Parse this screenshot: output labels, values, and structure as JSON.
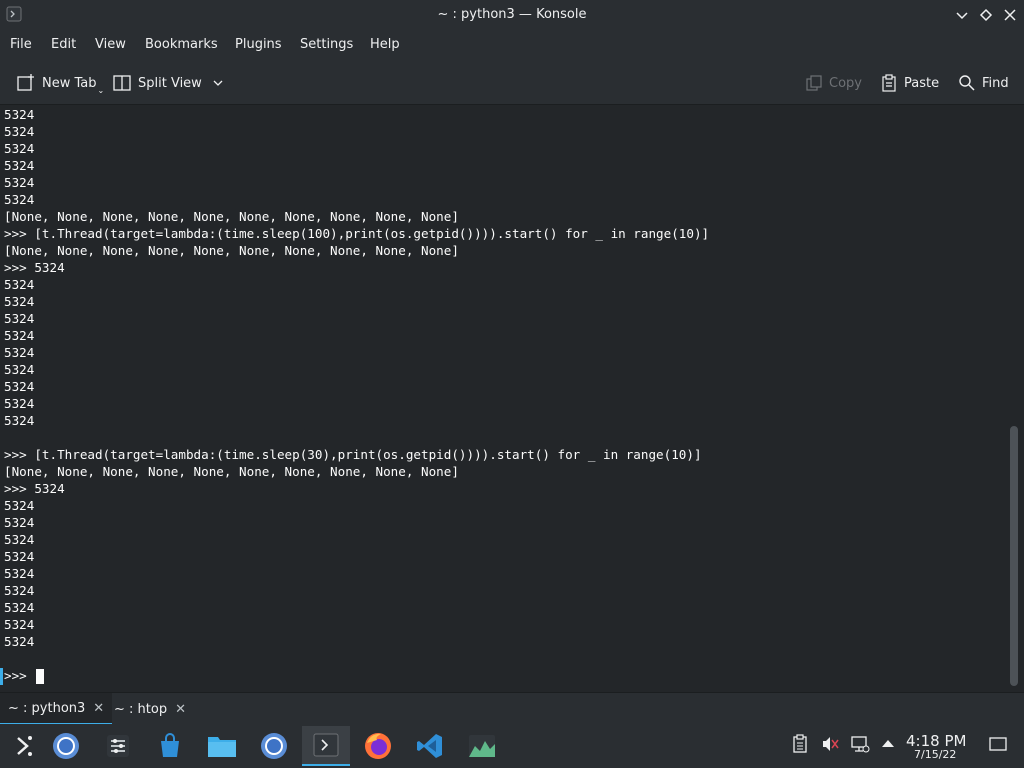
{
  "window": {
    "title": "~ : python3 — Konsole"
  },
  "menu": {
    "items": [
      "File",
      "Edit",
      "View",
      "Bookmarks",
      "Plugins",
      "Settings",
      "Help"
    ]
  },
  "toolbar": {
    "new_tab": "New Tab",
    "split_view": "Split View",
    "copy": "Copy",
    "paste": "Paste",
    "find": "Find"
  },
  "terminal": {
    "lines": [
      "5324",
      "5324",
      "5324",
      "5324",
      "5324",
      "5324",
      "[None, None, None, None, None, None, None, None, None, None]",
      ">>> [t.Thread(target=lambda:(time.sleep(100),print(os.getpid()))).start() for _ in range(10)]",
      "[None, None, None, None, None, None, None, None, None, None]",
      ">>> 5324",
      "5324",
      "5324",
      "5324",
      "5324",
      "5324",
      "5324",
      "5324",
      "5324",
      "5324",
      "",
      ">>> [t.Thread(target=lambda:(time.sleep(30),print(os.getpid()))).start() for _ in range(10)]",
      "[None, None, None, None, None, None, None, None, None, None]",
      ">>> 5324",
      "5324",
      "5324",
      "5324",
      "5324",
      "5324",
      "5324",
      "5324",
      "5324",
      "5324",
      "",
      ">>> "
    ]
  },
  "tabs": [
    {
      "label": "~ : python3",
      "active": true
    },
    {
      "label": "~ : htop",
      "active": false
    }
  ],
  "taskbar": {
    "apps": [
      "app-launcher",
      "chromium",
      "system-settings",
      "discover-store",
      "dolphin-files",
      "chromium",
      "konsole",
      "firefox",
      "vscode",
      "system-monitor"
    ],
    "clock_time": "4:18 PM",
    "clock_date": "7/15/22"
  },
  "colors": {
    "accent": "#3daee9",
    "terminal_bg": "#232629",
    "chrome_bg": "#2a2e32",
    "text": "#fcfcfc"
  }
}
